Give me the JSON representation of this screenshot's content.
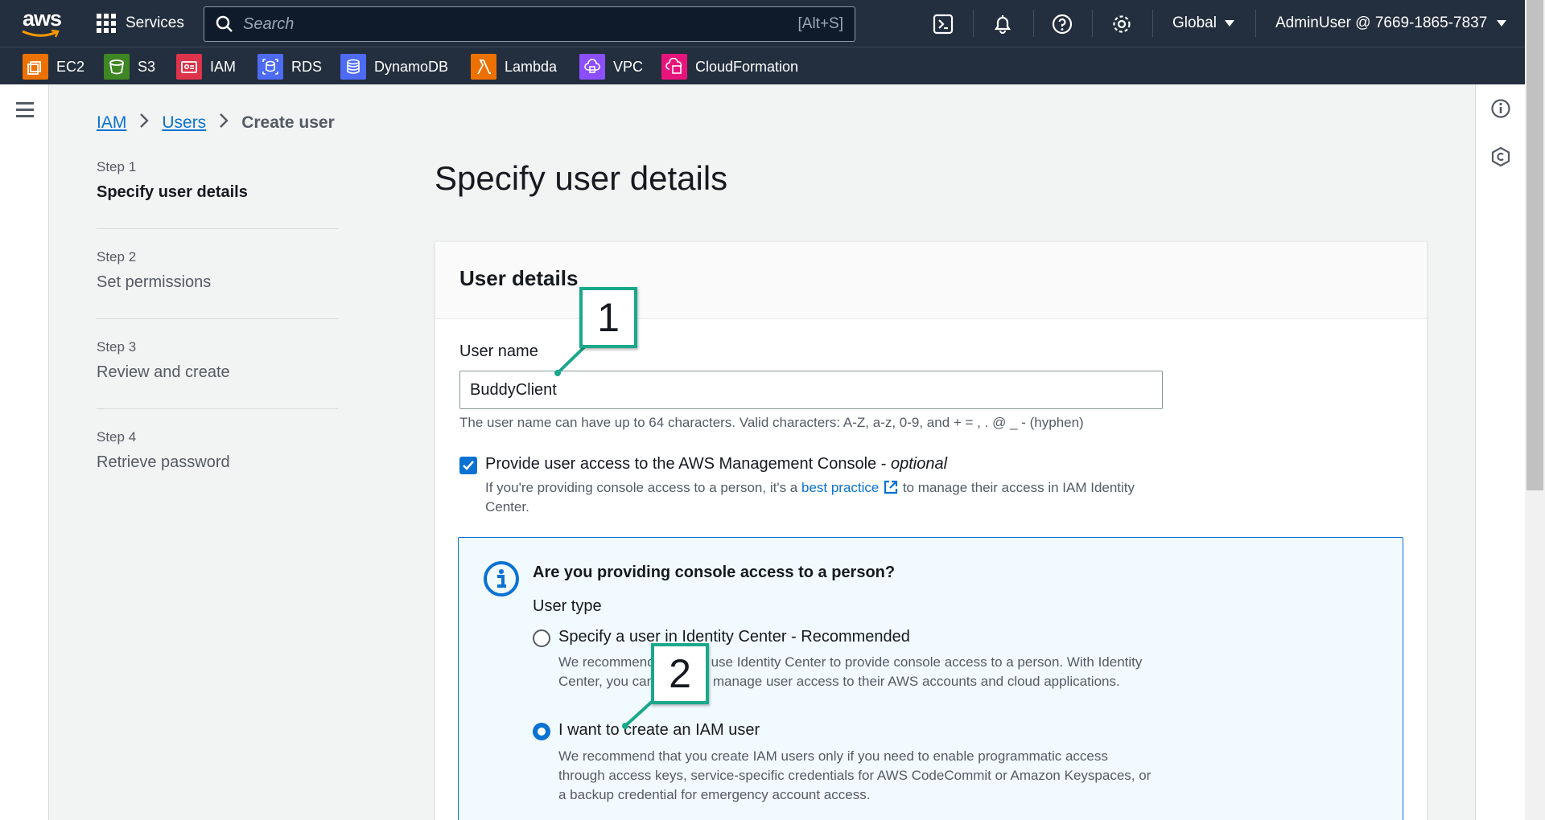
{
  "topbar": {
    "logo": "aws",
    "services_label": "Services",
    "search_placeholder": "Search",
    "search_shortcut": "[Alt+S]",
    "region": "Global",
    "account": "AdminUser @ 7669-1865-7837",
    "icons": [
      "cloudshell-icon",
      "bell-icon",
      "help-icon",
      "settings-icon"
    ]
  },
  "services": [
    {
      "label": "EC2",
      "color": "#ed7100",
      "icon": "ec2-icon"
    },
    {
      "label": "S3",
      "color": "#3f8624",
      "icon": "s3-icon"
    },
    {
      "label": "IAM",
      "color": "#dd344c",
      "icon": "iam-icon"
    },
    {
      "label": "RDS",
      "color": "#4d6bf3",
      "icon": "rds-icon"
    },
    {
      "label": "DynamoDB",
      "color": "#4d6bf3",
      "icon": "dynamodb-icon"
    },
    {
      "label": "Lambda",
      "color": "#ed7100",
      "icon": "lambda-icon"
    },
    {
      "label": "VPC",
      "color": "#8c4fff",
      "icon": "vpc-icon"
    },
    {
      "label": "CloudFormation",
      "color": "#e7157b",
      "icon": "cloudformation-icon"
    }
  ],
  "breadcrumb": {
    "items": [
      "IAM",
      "Users"
    ],
    "current": "Create user"
  },
  "steps": [
    {
      "num": "Step 1",
      "label": "Specify user details",
      "active": true
    },
    {
      "num": "Step 2",
      "label": "Set permissions",
      "active": false
    },
    {
      "num": "Step 3",
      "label": "Review and create",
      "active": false
    },
    {
      "num": "Step 4",
      "label": "Retrieve password",
      "active": false
    }
  ],
  "page_title": "Specify user details",
  "card": {
    "title": "User details",
    "username_label": "User name",
    "username_value": "BuddyClient",
    "username_hint": "The user name can have up to 64 characters. Valid characters: A-Z, a-z, 0-9, and + = , . @ _ - (hyphen)",
    "console_access_label": "Provide user access to the AWS Management Console - ",
    "console_access_optional": "optional",
    "console_access_checked": true,
    "console_desc_prefix": "If you're providing console access to a person, it's a ",
    "console_desc_link": "best practice",
    "console_desc_suffix": " to manage their access in IAM Identity Center."
  },
  "info_box": {
    "title": "Are you providing console access to a person?",
    "user_type_label": "User type",
    "options": [
      {
        "label": "Specify a user in Identity Center - Recommended",
        "desc": "We recommend that you use Identity Center to provide console access to a person. With Identity Center, you can centrally manage user access to their AWS accounts and cloud applications.",
        "selected": false
      },
      {
        "label": "I want to create an IAM user",
        "desc": "We recommend that you create IAM users only if you need to enable programmatic access through access keys, service-specific credentials for AWS CodeCommit or Amazon Keyspaces, or a backup credential for emergency account access.",
        "selected": true
      }
    ]
  },
  "callouts": [
    "1",
    "2"
  ],
  "colors": {
    "navbar": "#232f3e",
    "link": "#0972d3",
    "callout_border": "#1aa88c"
  }
}
